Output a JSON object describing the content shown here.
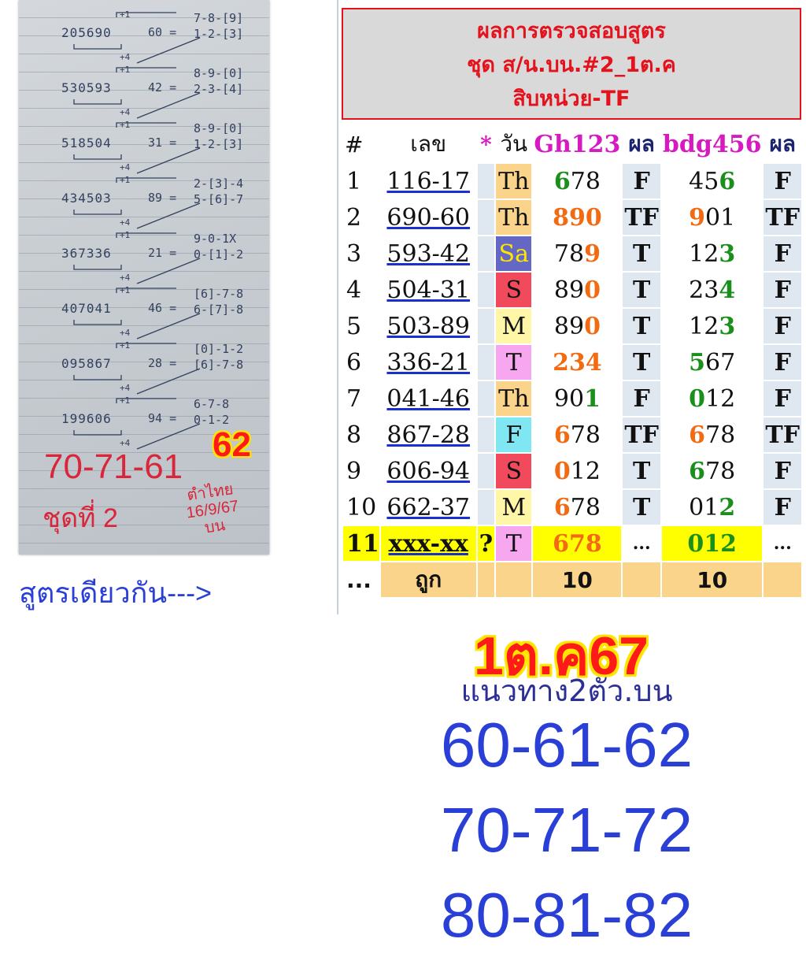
{
  "notebook": {
    "rows": [
      {
        "num": "205690",
        "eq": "60 =",
        "top": "7-8-[9]",
        "bot": "1-2-[3]"
      },
      {
        "num": "530593",
        "eq": "42 =",
        "top": "8-9-[0]",
        "bot": "2-3-[4]"
      },
      {
        "num": "518504",
        "eq": "31 =",
        "top": "8-9-[0]",
        "bot": "1-2-[3]"
      },
      {
        "num": "434503",
        "eq": "89 =",
        "top": "2-[3]-4",
        "bot": "5-[6]-7"
      },
      {
        "num": "367336",
        "eq": "21 =",
        "top": "9-0-1X",
        "bot": "0-[1]-2"
      },
      {
        "num": "407041",
        "eq": "46 =",
        "top": "[6]-7-8",
        "bot": "6-[7]-8"
      },
      {
        "num": "095867",
        "eq": "28 =",
        "top": "[0]-1-2",
        "bot": "[6]-7-8"
      },
      {
        "num": "199606",
        "eq": "94 =",
        "top": "6-7-8",
        "bot": "0-1-2"
      }
    ],
    "red_numbers": "70-71-61",
    "red_set": "ชุดที่ 2",
    "red_source": "ตำไทย",
    "red_date": "16/9/67",
    "red_pos": "บน",
    "badge": "62"
  },
  "left_caption": "สูตรเดียวกัน--->",
  "header": {
    "line1": "ผลการตรวจสอบสูตร",
    "line2": "ชุด ส/น.บน.#2_1ต.ค",
    "line3": "สิบหน่วย-TF"
  },
  "table": {
    "columns": {
      "idx": "#",
      "num": "เลข",
      "star": "*",
      "day": "วัน",
      "gh": "Gh123",
      "r1": "ผล",
      "bdg": "bdg456",
      "r2": "ผล"
    },
    "rows": [
      {
        "i": "1",
        "num": "116-17",
        "day": "Th",
        "day_bg": "#fbd48b",
        "gh": [
          "6",
          "78"
        ],
        "gh_hl": "g",
        "r1": "F",
        "bdg": [
          "45",
          "6"
        ],
        "bdg_hl": "g",
        "r2": "F"
      },
      {
        "i": "2",
        "num": "690-60",
        "day": "Th",
        "day_bg": "#fbd48b",
        "gh": [
          "8",
          "9",
          "0"
        ],
        "gh_hl": "o",
        "r1": "TF",
        "bdg": [
          "9",
          "01"
        ],
        "bdg_hl": "o",
        "r2": "TF"
      },
      {
        "i": "3",
        "num": "593-42",
        "day": "Sa",
        "day_bg": "#6467c4",
        "gh": [
          "78",
          "9"
        ],
        "gh_hl": "o",
        "r1": "T",
        "bdg": [
          "12",
          "3"
        ],
        "bdg_hl": "g",
        "r2": "F"
      },
      {
        "i": "4",
        "num": "504-31",
        "day": "S",
        "day_bg": "#f14a5c",
        "gh": [
          "89",
          "0"
        ],
        "gh_hl": "o",
        "r1": "T",
        "bdg": [
          "23",
          "4"
        ],
        "bdg_hl": "g",
        "r2": "F"
      },
      {
        "i": "5",
        "num": "503-89",
        "day": "M",
        "day_bg": "#fff6a8",
        "gh": [
          "89",
          "0"
        ],
        "gh_hl": "o",
        "r1": "T",
        "bdg": [
          "12",
          "3"
        ],
        "bdg_hl": "g",
        "r2": "F"
      },
      {
        "i": "6",
        "num": "336-21",
        "day": "T",
        "day_bg": "#f7a6f0",
        "gh": [
          "2",
          "3",
          "4"
        ],
        "gh_hl": "o",
        "r1": "T",
        "bdg": [
          "5",
          "67"
        ],
        "bdg_hl": "g",
        "r2": "F"
      },
      {
        "i": "7",
        "num": "041-46",
        "day": "Th",
        "day_bg": "#fbd48b",
        "gh": [
          "90",
          "1"
        ],
        "gh_hl": "g",
        "r1": "F",
        "bdg": [
          "0",
          "12"
        ],
        "bdg_hl": "g",
        "r2": "F"
      },
      {
        "i": "8",
        "num": "867-28",
        "day": "F",
        "day_bg": "#7fe6f2",
        "gh": [
          "6",
          "78"
        ],
        "gh_hl": "o",
        "r1": "TF",
        "bdg": [
          "6",
          "78"
        ],
        "bdg_hl": "o",
        "r2": "TF"
      },
      {
        "i": "9",
        "num": "606-94",
        "day": "S",
        "day_bg": "#f14a5c",
        "gh": [
          "0",
          "12"
        ],
        "gh_hl": "o",
        "r1": "T",
        "bdg": [
          "6",
          "78"
        ],
        "bdg_hl": "g",
        "r2": "F"
      },
      {
        "i": "10",
        "num": "662-37",
        "day": "M",
        "day_bg": "#fff6a8",
        "gh": [
          "6",
          "78"
        ],
        "gh_hl": "o",
        "r1": "T",
        "bdg": [
          "01",
          "2"
        ],
        "bdg_hl": "g",
        "r2": "F"
      }
    ],
    "pending": {
      "i": "11",
      "num": "xxx-xx",
      "q": "?",
      "day": "T",
      "day_bg": "#f7a6f0",
      "gh": "678",
      "r1": "...",
      "bdg": "012",
      "r2": "..."
    },
    "total": {
      "dots": "...",
      "label": "ถูก",
      "gh": "10",
      "bdg": "10"
    }
  },
  "date_big": "1ต.ค67",
  "guide_label": "แนวทาง2ตัว.บน",
  "predictions": [
    "60-61-62",
    "70-71-72",
    "80-81-82"
  ]
}
